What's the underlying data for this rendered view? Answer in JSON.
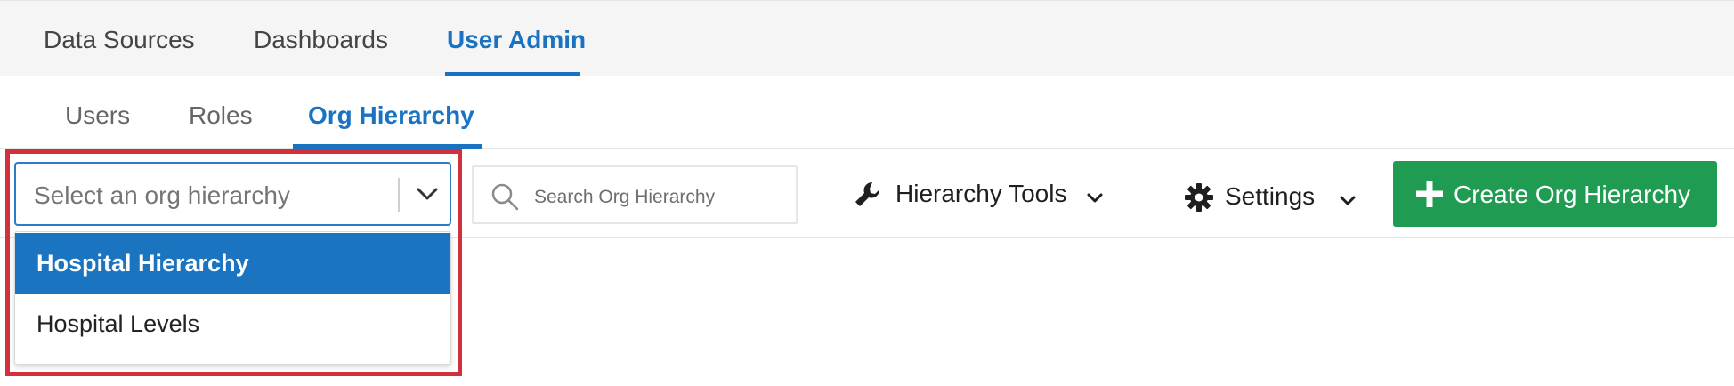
{
  "topnav": {
    "tabs": [
      {
        "label": "Data Sources"
      },
      {
        "label": "Dashboards"
      },
      {
        "label": "User Admin"
      }
    ],
    "active_tab": "User Admin"
  },
  "subnav": {
    "tabs": [
      {
        "label": "Users"
      },
      {
        "label": "Roles"
      },
      {
        "label": "Org Hierarchy"
      }
    ],
    "active_tab": "Org Hierarchy"
  },
  "hierarchy_select": {
    "placeholder": "Select an org hierarchy",
    "icon": "chevron-down-icon",
    "expanded": true,
    "options": [
      {
        "label": "Hospital Hierarchy",
        "highlighted": true
      },
      {
        "label": "Hospital Levels",
        "highlighted": false
      }
    ]
  },
  "search": {
    "placeholder": "Search Org Hierarchy",
    "icon": "search-icon"
  },
  "toolbar": {
    "hierarchy_tools_label": "Hierarchy Tools",
    "hierarchy_tools_icon": "wrench-icon",
    "settings_label": "Settings",
    "settings_icon": "gear-icon",
    "create_label": "Create Org Hierarchy",
    "create_icon": "plus-icon"
  },
  "colors": {
    "accent": "#1a73c1",
    "create_button": "#1f9c52",
    "highlight_box": "#d0313c",
    "selected_option": "#1b74c0"
  }
}
